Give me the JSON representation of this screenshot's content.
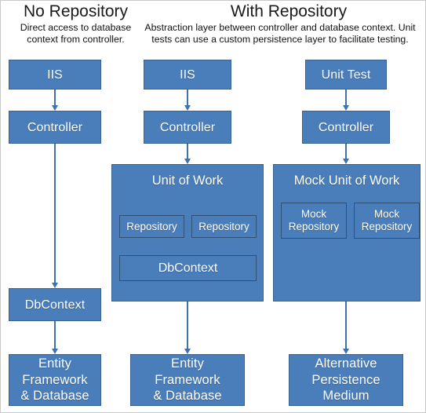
{
  "diagram": {
    "title_left": "No Repository",
    "title_right": "With Repository",
    "desc_left": "Direct access to database context from controller.",
    "desc_right": "Abstraction layer between controller and database context. Unit tests can use a custom persistence layer to facilitate testing.",
    "colors": {
      "box_fill": "#4a7ebb",
      "box_border": "#39608f",
      "inner_border": "#2f5176",
      "arrow": "#3f72ad",
      "text": "#ffffff",
      "page_background": "#ffffff"
    }
  },
  "columns": [
    {
      "id": "no-repository",
      "nodes": {
        "host": "IIS",
        "controller": "Controller",
        "dbcontext": "DbContext",
        "persistence": "Entity\nFramework\n& Database"
      }
    },
    {
      "id": "with-repository",
      "nodes": {
        "host": "IIS",
        "controller": "Controller",
        "unit_of_work": "Unit of Work",
        "repository_1": "Repository",
        "repository_2": "Repository",
        "dbcontext": "DbContext",
        "persistence": "Entity\nFramework\n& Database"
      }
    },
    {
      "id": "with-repository-tests",
      "nodes": {
        "host": "Unit Test",
        "controller": "Controller",
        "unit_of_work": "Mock Unit of Work",
        "repository_1": "Mock\nRepository",
        "repository_2": "Mock\nRepository",
        "persistence": "Alternative\nPersistence\nMedium"
      }
    }
  ]
}
